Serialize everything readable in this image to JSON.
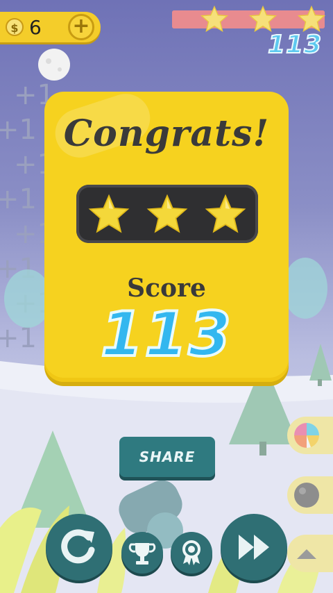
{
  "hud": {
    "currency_symbol": "$",
    "coins": "6",
    "add_coins_label": "+",
    "level_score": "113",
    "stars_earned": 3,
    "stars_total": 3
  },
  "result_panel": {
    "title": "Congrats!",
    "stars_earned": 3,
    "stars_total": 3,
    "score_label": "Score",
    "score_value": "113"
  },
  "share": {
    "label": "SHARE"
  },
  "side_buttons": [
    {
      "icon": "beach-ball-icon"
    },
    {
      "icon": "gray-ball-icon"
    },
    {
      "icon": "triangle-up-icon"
    }
  ],
  "bottom_buttons": [
    {
      "icon": "restart-icon"
    },
    {
      "icon": "trophy-icon"
    },
    {
      "icon": "ribbon-award-icon"
    },
    {
      "icon": "fast-forward-icon"
    }
  ],
  "colors": {
    "panel_yellow": "#f6d21f",
    "score_blue": "#33b7ef",
    "button_teal": "#2f6f74",
    "progress_red": "#e88b8f"
  }
}
